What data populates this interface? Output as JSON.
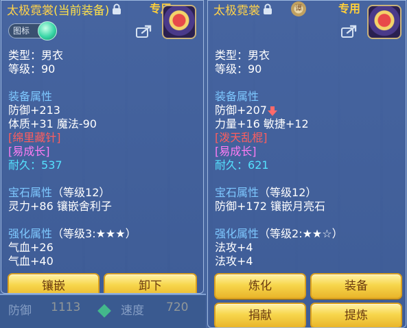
{
  "background": {
    "stat_label": "防御",
    "stat_value": "1113",
    "speed_label": "速度",
    "speed_value": "720"
  },
  "left_panel": {
    "item_name": "太极霓裳",
    "equipped_tag": "(当前装备)",
    "exclusive_label": "专用",
    "icon_toggle_label": "图标",
    "type_line": "类型：男衣",
    "level_line": "等级：90",
    "attr_header": "装备属性",
    "attr_lines": [
      "防御+213",
      "体质+31 魔法-90"
    ],
    "special_red": "[绵里藏针]",
    "special_magenta": "[易成长]",
    "durability_label": "耐久：",
    "durability_value": "537",
    "gem_header": "宝石属性",
    "gem_level": "（等级12）",
    "gem_line": "灵力+86 镶嵌舍利子",
    "enhance_header": "强化属性",
    "enhance_level": "（等级3:★★★）",
    "enhance_lines": [
      "气血+26",
      "气血+40"
    ],
    "buttons": [
      "镶嵌",
      "卸下"
    ]
  },
  "right_panel": {
    "item_name": "太极霓裳",
    "exclusive_label": "专用",
    "seal_text": "谭",
    "type_line": "类型：男衣",
    "level_line": "等级：90",
    "attr_header": "装备属性",
    "attr_lines": [
      "防御+207",
      "力量+16 敏捷+12"
    ],
    "special_red": "[泼天乱棍]",
    "special_magenta": "[易成长]",
    "durability_label": "耐久：",
    "durability_value": "621",
    "gem_header": "宝石属性",
    "gem_level": "（等级12）",
    "gem_line": "防御+172 镶嵌月亮石",
    "enhance_header": "强化属性",
    "enhance_level": "（等级2:★★☆）",
    "enhance_lines": [
      "法攻+4",
      "法攻+4"
    ],
    "buttons": [
      "炼化",
      "装备",
      "捐献",
      "提炼"
    ]
  },
  "colors": {
    "title": "#ffd24a",
    "section": "#7ec8ff",
    "special_red": "#ff5e5e",
    "special_magenta": "#ff7cf4",
    "durability": "#55e2ff",
    "button": "#f7d64c"
  }
}
